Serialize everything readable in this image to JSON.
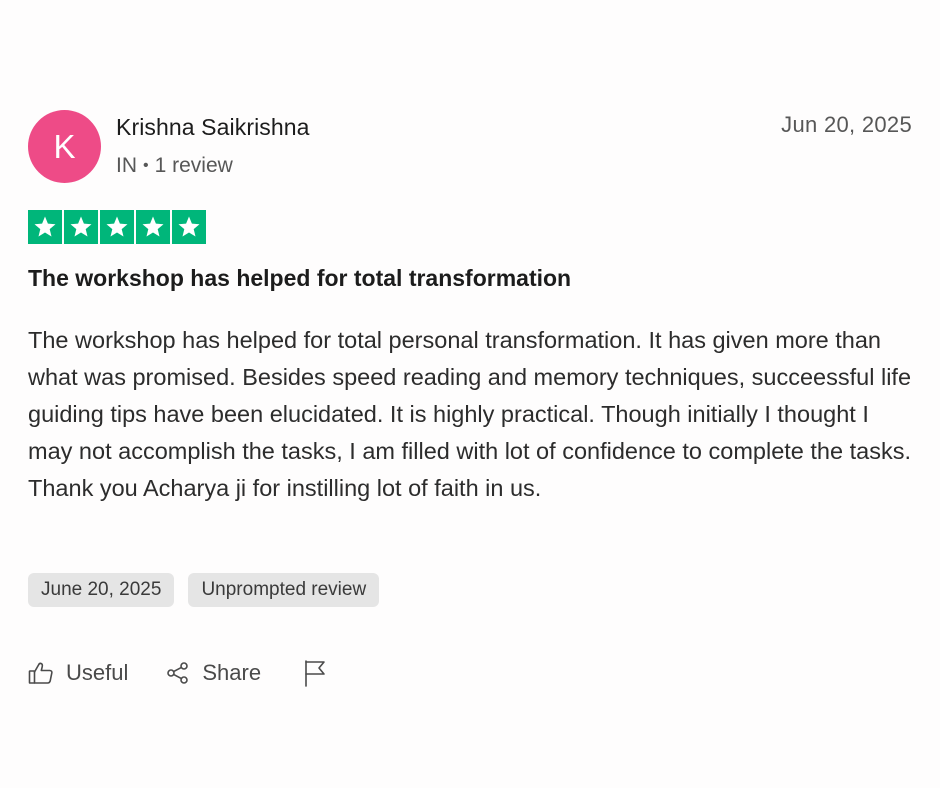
{
  "colors": {
    "avatar_bg": "#ee4b87",
    "star_bg": "#00b67a",
    "star_fill": "#ffffff"
  },
  "reviewer": {
    "initial": "K",
    "name": "Krishna Saikrishna",
    "country": "IN",
    "separator": "•",
    "review_count": "1 review"
  },
  "review": {
    "date": "Jun 20, 2025",
    "rating": 5,
    "title": "The workshop has helped for total transformation",
    "body": "The workshop has helped for total personal transformation. It has given more than what was promised. Besides speed reading and memory techniques, succeessful life guiding tips have been elucidated. It is highly practical. Though initially I thought I may not accomplish the tasks, I am filled with lot of confidence to complete the tasks. Thank you Acharya ji for instilling lot of faith in us.",
    "tags": [
      "June 20, 2025",
      "Unprompted review"
    ]
  },
  "actions": {
    "useful_label": "Useful",
    "useful_icon": "thumbs-up-icon",
    "share_label": "Share",
    "share_icon": "share-icon",
    "report_icon": "flag-icon"
  }
}
